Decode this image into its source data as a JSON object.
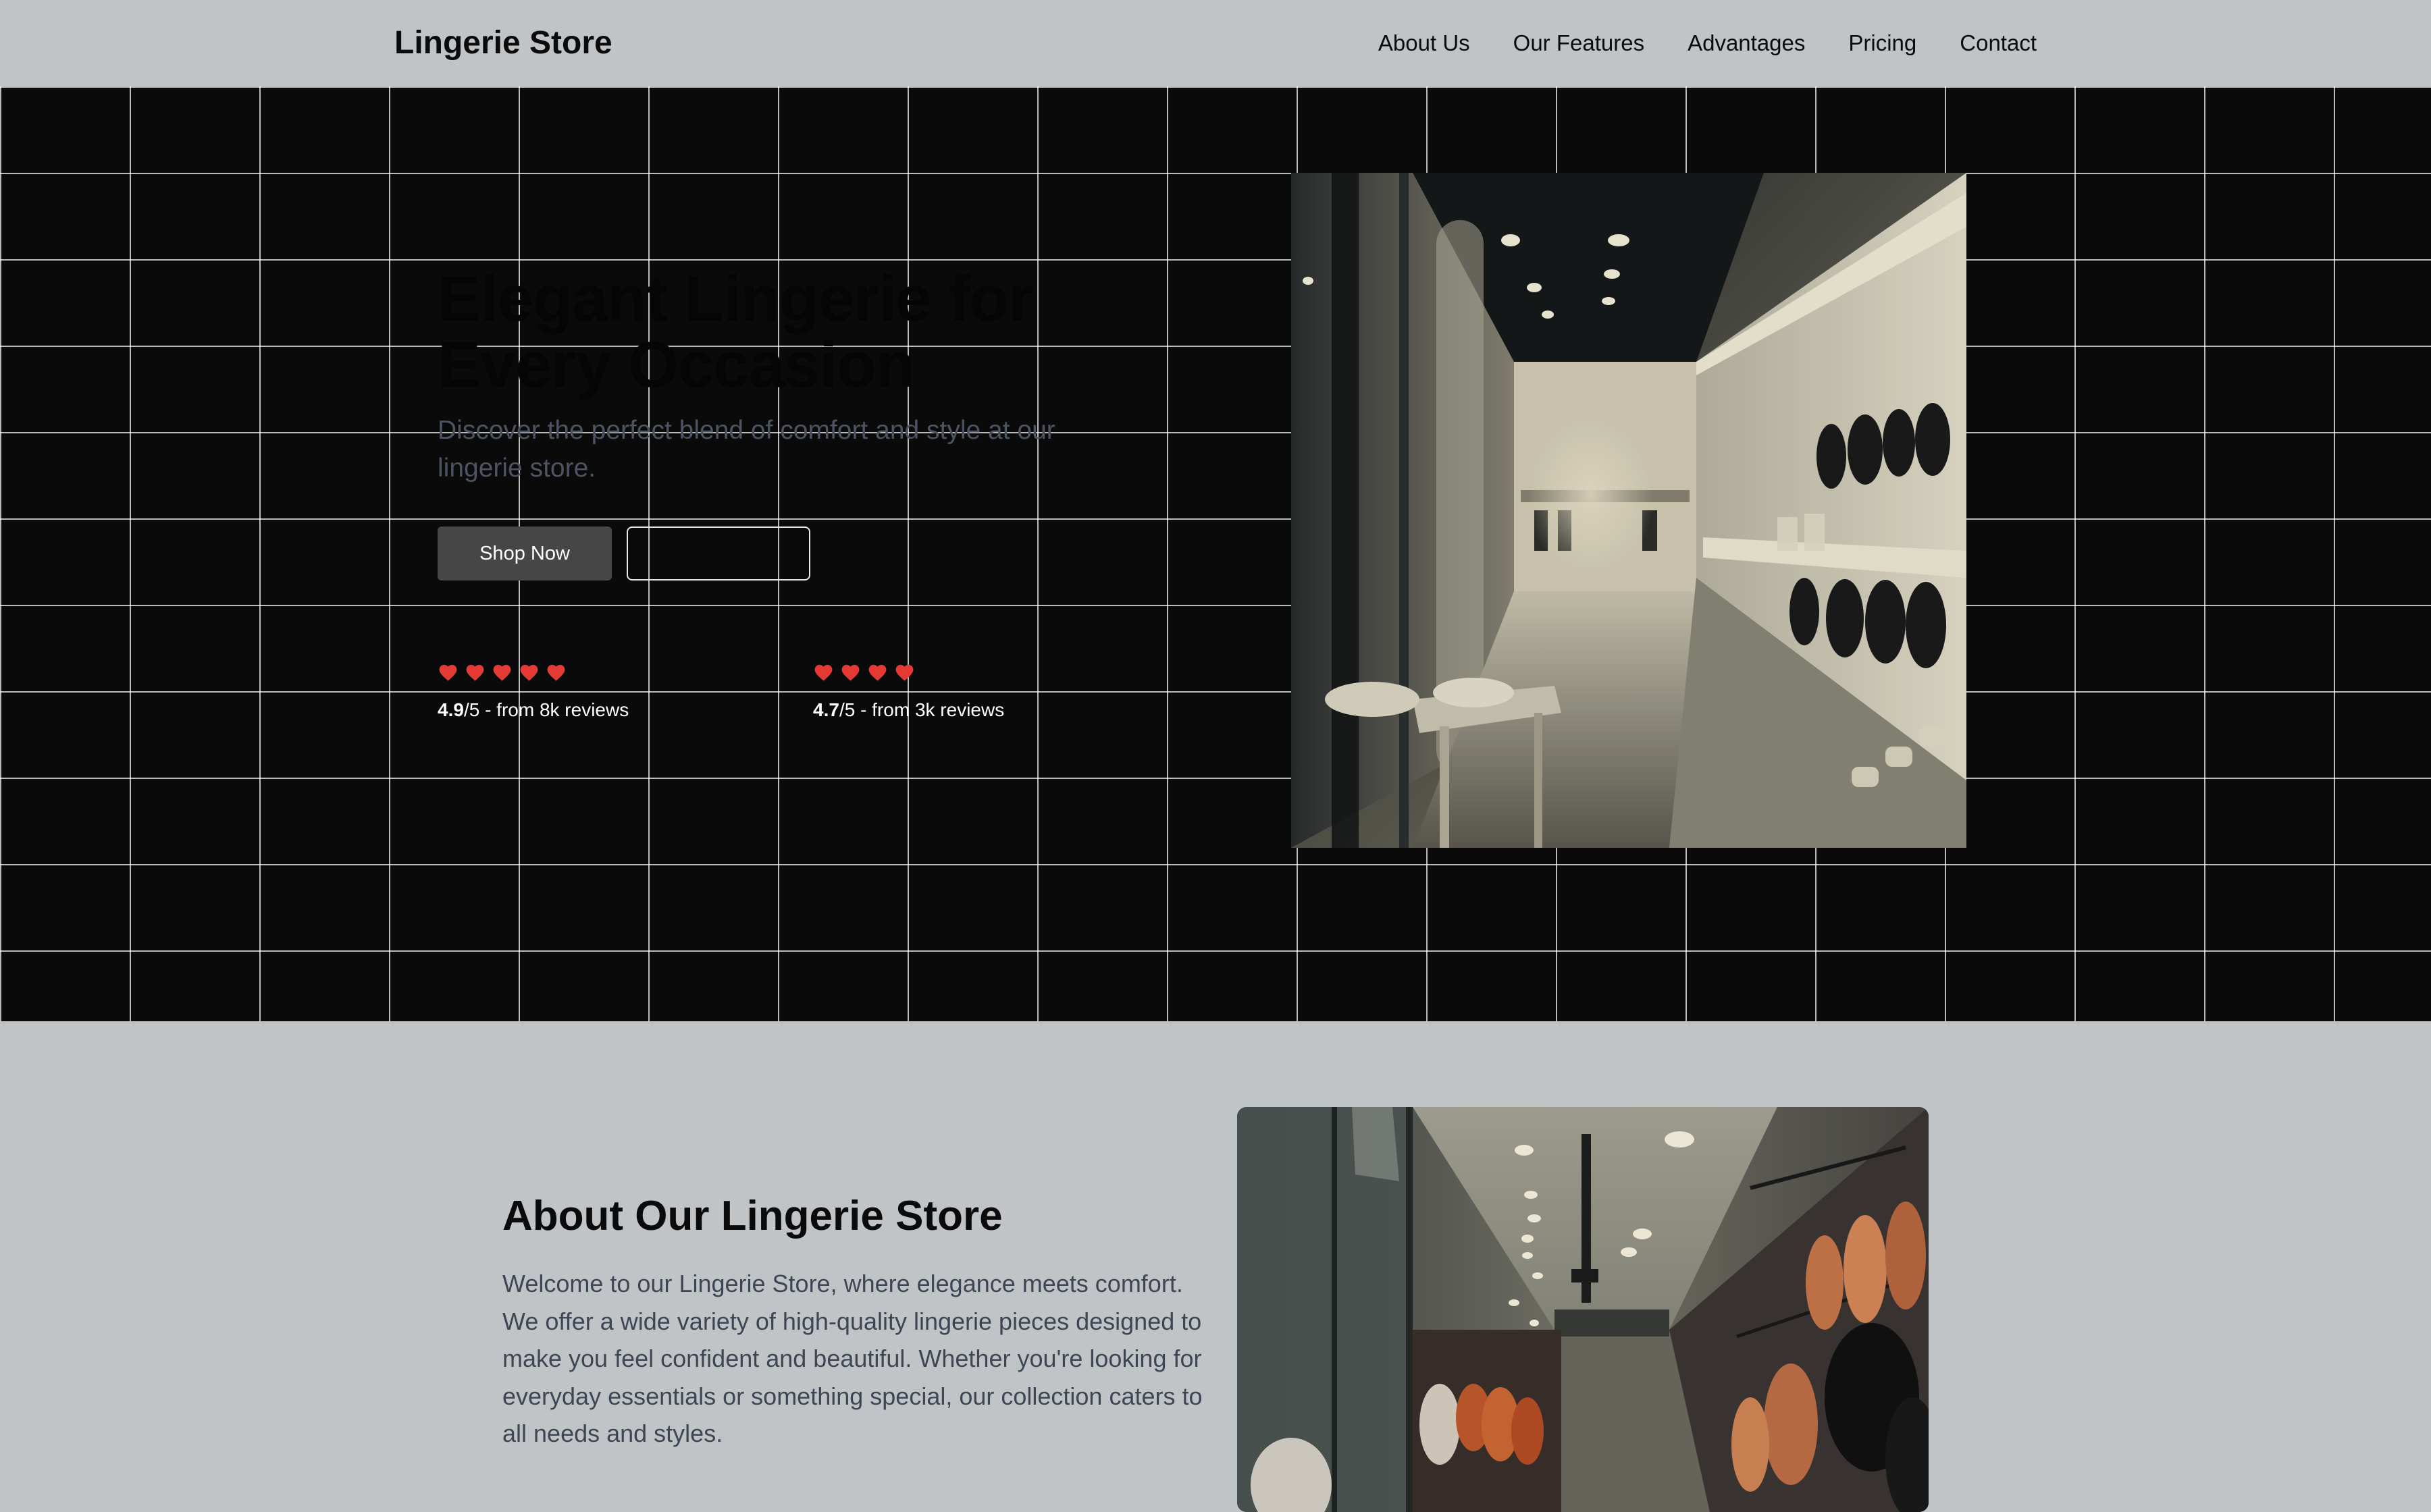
{
  "header": {
    "brand": "Lingerie Store",
    "nav": [
      "About Us",
      "Our Features",
      "Advantages",
      "Pricing",
      "Contact"
    ]
  },
  "hero": {
    "title": "Elegant Lingerie for Every Occasion",
    "subtitle": "Discover the perfect blend of comfort and style at our lingerie store.",
    "primary_button": "Shop Now",
    "secondary_button": "",
    "ratings": [
      {
        "score": "4.9",
        "suffix": "/5 - from 8k reviews",
        "hearts": 5
      },
      {
        "score": "4.7",
        "suffix": "/5 - from 3k reviews",
        "hearts": 4
      }
    ],
    "image": {
      "icon": "store-interior-photo"
    }
  },
  "about": {
    "title": "About Our Lingerie Store",
    "text": "Welcome to our Lingerie Store, where elegance meets comfort. We offer a wide variety of high-quality lingerie pieces designed to make you feel confident and beautiful. Whether you're looking for everyday essentials or something special, our collection caters to all needs and styles.",
    "image": {
      "icon": "boutique-interior-photo"
    }
  },
  "colors": {
    "page_bg": "#c1c4c7",
    "hero_bg": "#0a0a0b",
    "grid_line": "#bdbdbd",
    "heart": "#e53935",
    "button_bg": "#464647",
    "subtitle": "#4c5361",
    "body_text": "#3e4653"
  }
}
